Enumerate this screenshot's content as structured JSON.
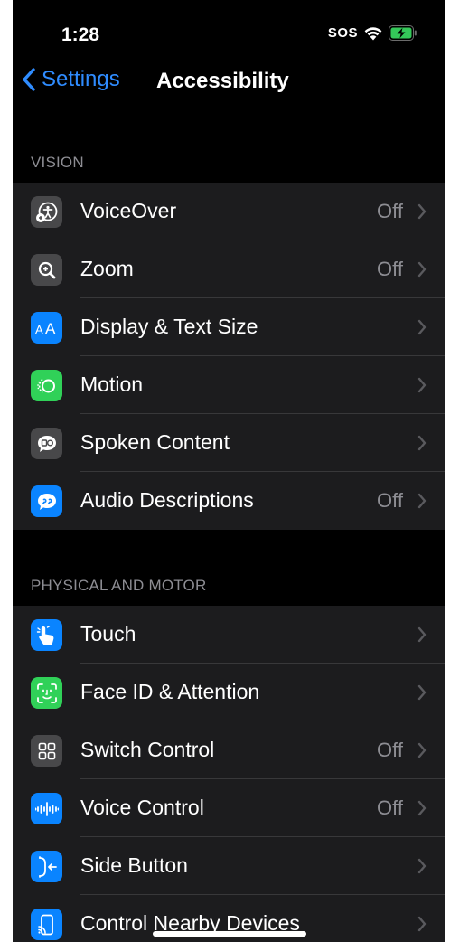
{
  "status_bar": {
    "time": "1:28",
    "carrier": "SOS"
  },
  "nav": {
    "back_label": "Settings",
    "title": "Accessibility"
  },
  "sections": {
    "vision": {
      "header": "VISION",
      "items": [
        {
          "label": "VoiceOver",
          "value": "Off",
          "icon": "voiceover-icon",
          "icon_bg": "#48484a"
        },
        {
          "label": "Zoom",
          "value": "Off",
          "icon": "zoom-icon",
          "icon_bg": "#48484a"
        },
        {
          "label": "Display & Text Size",
          "value": "",
          "icon": "text-size-icon",
          "icon_bg": "#0a84ff"
        },
        {
          "label": "Motion",
          "value": "",
          "icon": "motion-icon",
          "icon_bg": "#30d158"
        },
        {
          "label": "Spoken Content",
          "value": "",
          "icon": "spoken-content-icon",
          "icon_bg": "#48484a"
        },
        {
          "label": "Audio Descriptions",
          "value": "Off",
          "icon": "audio-descriptions-icon",
          "icon_bg": "#0a84ff"
        }
      ]
    },
    "physical": {
      "header": "PHYSICAL AND MOTOR",
      "items": [
        {
          "label": "Touch",
          "value": "",
          "icon": "touch-icon",
          "icon_bg": "#0a84ff"
        },
        {
          "label": "Face ID & Attention",
          "value": "",
          "icon": "face-id-icon",
          "icon_bg": "#30d158"
        },
        {
          "label": "Switch Control",
          "value": "Off",
          "icon": "switch-control-icon",
          "icon_bg": "#48484a"
        },
        {
          "label": "Voice Control",
          "value": "Off",
          "icon": "voice-control-icon",
          "icon_bg": "#0a84ff"
        },
        {
          "label": "Side Button",
          "value": "",
          "icon": "side-button-icon",
          "icon_bg": "#0a84ff"
        },
        {
          "label": "Control Nearby Devices",
          "value": "",
          "icon": "nearby-devices-icon",
          "icon_bg": "#0a84ff"
        }
      ]
    }
  },
  "colors": {
    "accent": "#2f8cff",
    "background": "#000000",
    "cell_background": "#1c1c1e",
    "secondary_text": "#8d8d93",
    "separator": "#38383a"
  }
}
